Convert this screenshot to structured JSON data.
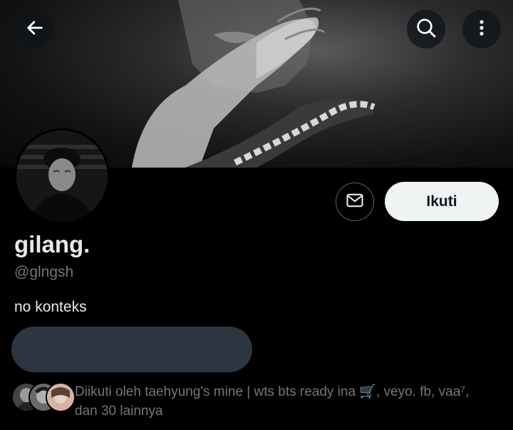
{
  "header": {
    "back_icon": "arrow-left-icon",
    "search_icon": "search-icon",
    "more_icon": "more-vertical-icon"
  },
  "profile": {
    "display_name": "gilang.",
    "handle": "@glngsh",
    "bio": "no konteks",
    "follow_label": "Ikuti",
    "message_icon": "envelope-icon"
  },
  "followed_by": {
    "text": "Diikuti oleh taehyung's mine | wts bts ready ina 🛒, veyo. fb, vaa⁷, dan 30 lainnya"
  },
  "colors": {
    "background": "#000000",
    "primary_text": "#e7e9ea",
    "secondary_text": "#71767b",
    "follow_button_bg": "#eff3f4",
    "pill_placeholder": "#2b3640"
  }
}
